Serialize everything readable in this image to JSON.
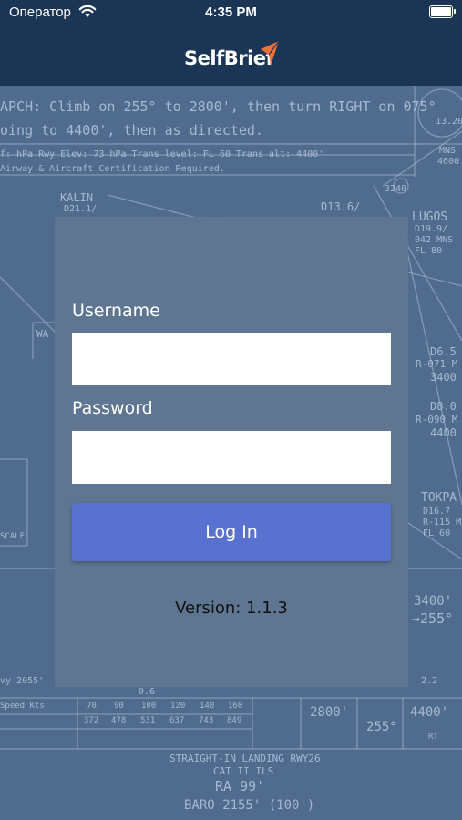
{
  "status_bar": {
    "carrier": "Оператор",
    "time": "4:35 PM"
  },
  "header": {
    "logo_text": "SelfBrief",
    "accent_color": "#f0703a"
  },
  "login": {
    "username_label": "Username",
    "username_value": "",
    "password_label": "Password",
    "password_value": "",
    "login_label": "Log In",
    "button_color": "#5a72cf"
  },
  "footer": {
    "version": "Version: 1.1.3"
  },
  "background_chart": {
    "line1": "APCH:  Climb on 255° to 2800', then turn RIGHT on 075°",
    "line2": "oing to 4400', then as directed.",
    "line3": "f: hPa        Rwy Elev: 73 hPa        Trans level: FL 60        Trans alt: 4400'",
    "line4": "Airway & Aircraft Certification Required.",
    "kalin": "KALIN",
    "kalin_dist": "D21.1/",
    "d136": "D13.6/",
    "lugos": "LUGOS",
    "lugos_r1": "D19.9/",
    "lugos_r2": "042 MNS",
    "lugos_r3": "FL 80",
    "mns": "MNS",
    "d65": "D6.5",
    "r071": "R-071 M",
    "alt3400": "3400",
    "d80": "D8.0",
    "r090": "R-090 M",
    "alt4400": "4400",
    "tokpa": "TOKPA",
    "tokpa_r1": "D16.7",
    "tokpa_r2": "R-115 M",
    "tokpa_r3": "FL 60",
    "alt3400b": "3400'",
    "hdg255": "→255°",
    "r1320": "13.20",
    "r4600": "4600",
    "r3240": "3240",
    "wa": "WA",
    "speed_label": "Speed Kts",
    "speeds": [
      "70",
      "90",
      "100",
      "120",
      "140",
      "160"
    ],
    "times": [
      "372",
      "478",
      "531",
      "637",
      "743",
      "849"
    ],
    "alt2800": "2800'",
    "hdg255b": "255°",
    "alt4400b": "4400'",
    "rt": "RT",
    "landing": "STRAIGHT-IN LANDING RWY26",
    "cat": "CAT II ILS",
    "ra": "RA 99'",
    "baro": "BARO 2155' (100')",
    "rvy": "vy 2055'",
    "scale": "SCALE",
    "frac06": "0.6",
    "frac22": "2.2"
  }
}
